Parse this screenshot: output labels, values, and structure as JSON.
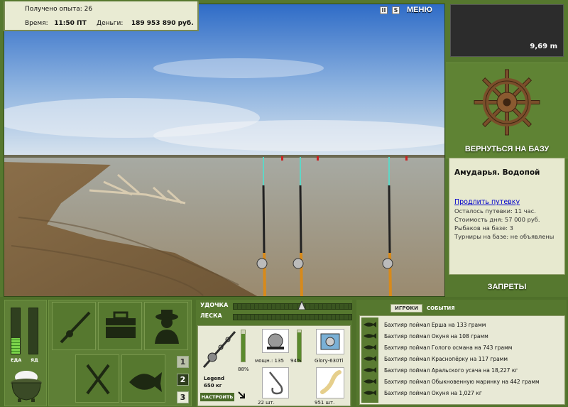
{
  "status": {
    "exp_label": "Получено опыта:",
    "exp_value": "26",
    "time_label": "Время:",
    "time_value": "11:50 ПТ",
    "money_label": "Деньги:",
    "money_value": "189 953 890 руб."
  },
  "hud": {
    "pause_glyph": "II",
    "sound_glyph": "S",
    "menu_label": "МЕНЮ"
  },
  "depth": {
    "value": "9,69 m"
  },
  "base": {
    "return_label": "ВЕРНУТЬСЯ НА БАЗУ",
    "location_title": "Амударья. Водопой",
    "extend_link": "Продлить путевку",
    "lines": [
      "Осталось путевки: 11 час.",
      "Стоимость дня: 57 000 руб.",
      "Рыбаков на базе: 3",
      "Турниры на базе: не объявлены"
    ],
    "bans_label": "ЗАПРЕТЫ"
  },
  "needs": {
    "food_label": "ЕДА",
    "poison_label": "ЯД",
    "food_level": 0.35,
    "poison_level": 0.0
  },
  "slots": [
    "1",
    "2",
    "3"
  ],
  "tackle": {
    "rod_label": "УДОЧКА",
    "line_label": "ЛЕСКА",
    "rod_tension": 0.0,
    "line_tension": 0.0,
    "rod_name": "Legend",
    "rod_capacity": "650 кг",
    "rod_condition": "88%",
    "tune_label": "НАСТРОИТЬ",
    "reel_power": "мощн.: 135",
    "reel_condition": "94%",
    "line_name": "Glory-630Ti",
    "hooks_count": "22 шт.",
    "bait_count": "951 шт."
  },
  "log": {
    "tab_players": "ИГРОКИ",
    "tab_events": "СОБЫТИЯ",
    "entries": [
      "Бахтияр поймал Ерша на 133 грамм",
      "Бахтияр поймал Окуня на 108 грамм",
      "Бахтияр поймал Голого османа на 743 грамм",
      "Бахтияр поймал Краснопёрку на 117 грамм",
      "Бахтияр поймал Аральского усача на 18,227 кг",
      "Бахтияр поймал Обыкновенную маринку на 442 грамм",
      "Бахтияр поймал Окуня на 1,027 кг"
    ]
  },
  "colors": {
    "panel_green": "#56782f",
    "panel_light": "#e8e9d6",
    "link_blue": "#0000cc"
  }
}
